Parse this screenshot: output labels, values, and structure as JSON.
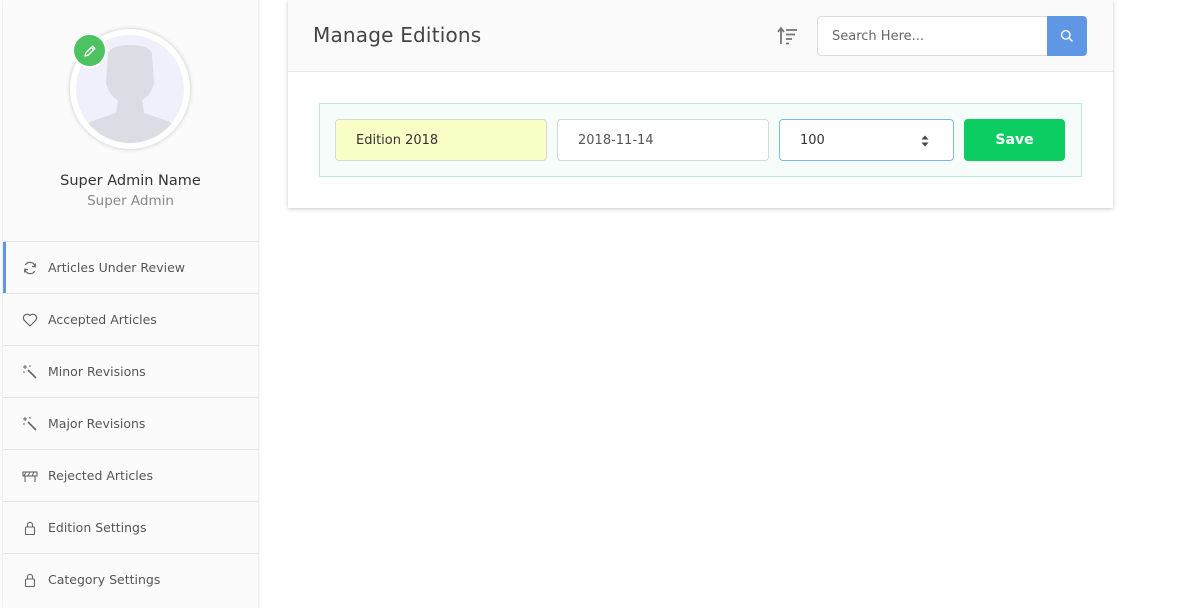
{
  "profile": {
    "name": "Super Admin Name",
    "role": "Super Admin",
    "edit_icon": "pencil-icon",
    "badge_color": "#4cc360"
  },
  "sidebar": {
    "accent_color": "#5f97e5",
    "items": [
      {
        "label": "Articles Under Review",
        "icon": "refresh-icon",
        "active": true
      },
      {
        "label": "Accepted Articles",
        "icon": "heart-icon",
        "active": false
      },
      {
        "label": "Minor Revisions",
        "icon": "magic-wand-icon",
        "active": false
      },
      {
        "label": "Major Revisions",
        "icon": "magic-wand-icon",
        "active": false
      },
      {
        "label": "Rejected Articles",
        "icon": "barrier-icon",
        "active": false
      },
      {
        "label": "Edition Settings",
        "icon": "lock-icon",
        "active": false
      },
      {
        "label": "Category Settings",
        "icon": "lock-icon",
        "active": false
      }
    ]
  },
  "header": {
    "title": "Manage Editions",
    "sort_icon": "sort-icon",
    "search_placeholder": "Search Here...",
    "search_icon": "search-icon"
  },
  "form": {
    "edition_name": "Edition 2018",
    "edition_date": "2018-11-14",
    "edition_number": "100",
    "save_label": "Save",
    "save_color": "#0ccd62"
  }
}
